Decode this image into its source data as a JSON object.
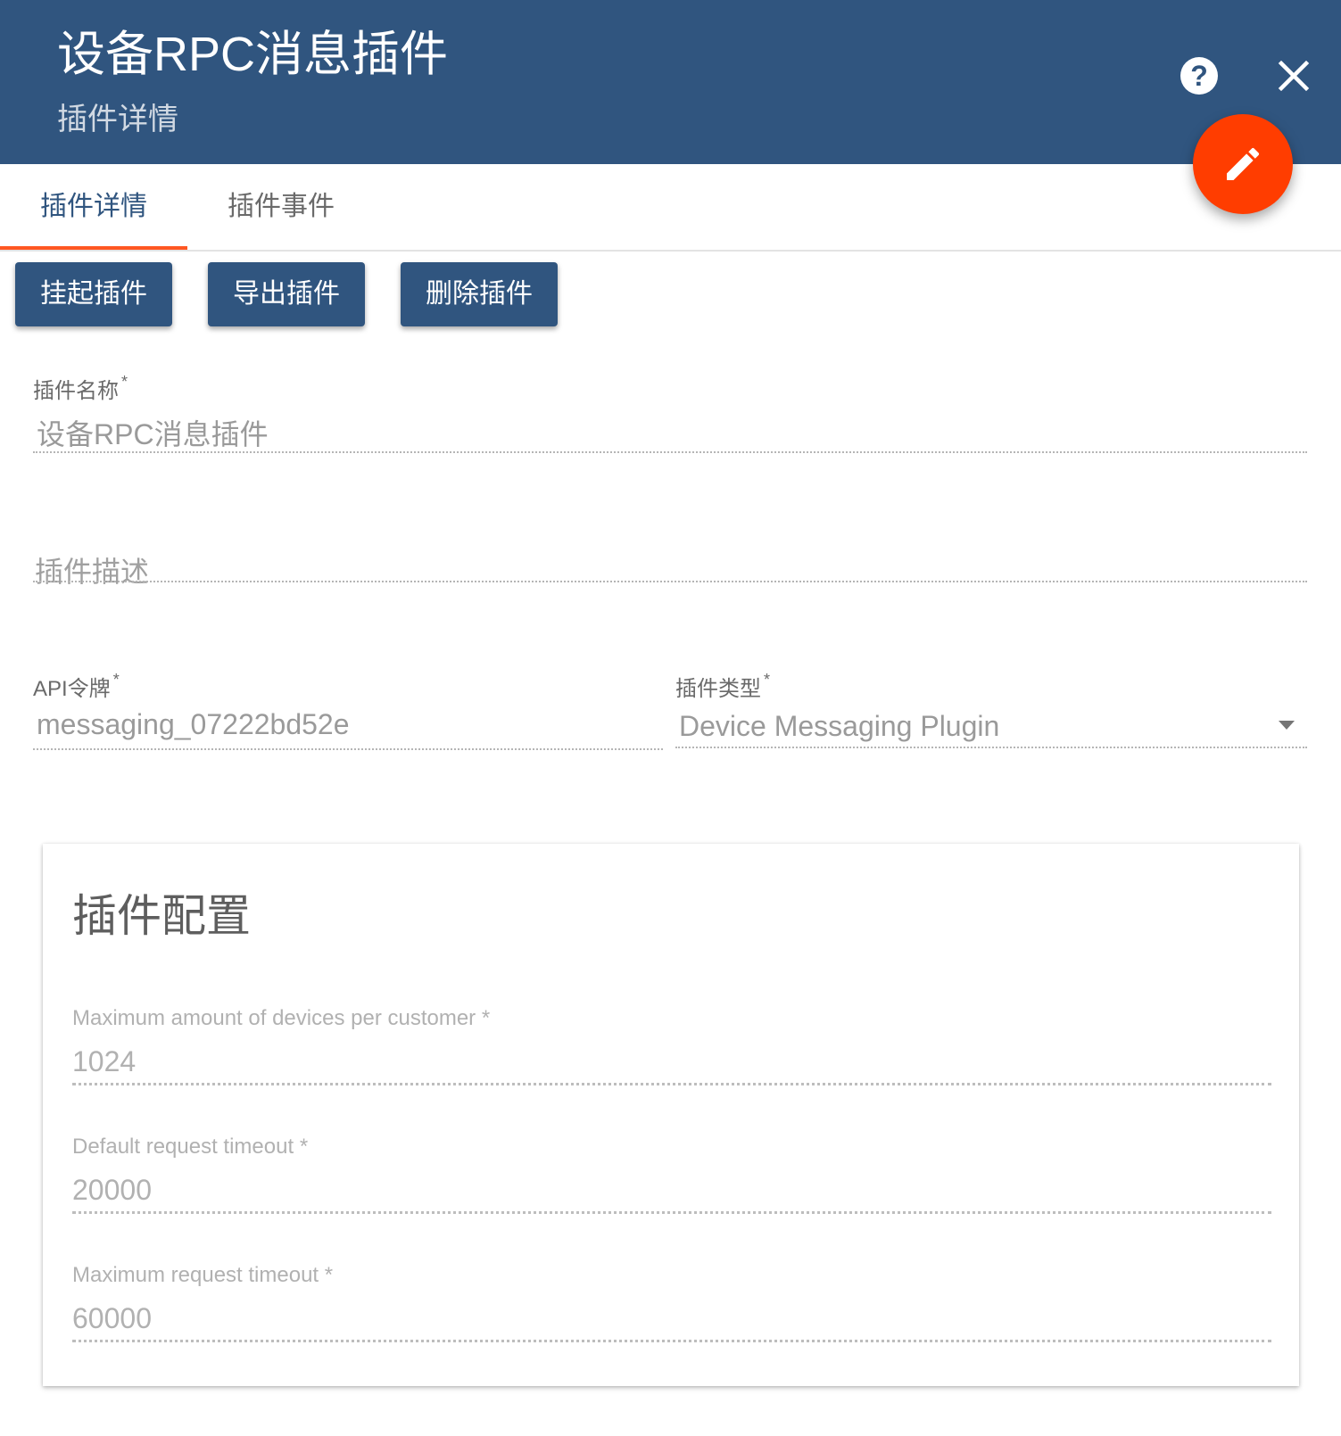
{
  "header": {
    "title": "设备RPC消息插件",
    "subtitle": "插件详情"
  },
  "icons": {
    "help": "help-icon",
    "close": "close-icon",
    "edit": "pencil-icon"
  },
  "colors": {
    "header_bg": "#30557f",
    "accent": "#ff5722",
    "fab": "#ff3d00"
  },
  "tabs": [
    {
      "label": "插件详情",
      "active": true
    },
    {
      "label": "插件事件",
      "active": false
    }
  ],
  "actions": {
    "suspend": "挂起插件",
    "export": "导出插件",
    "delete": "删除插件"
  },
  "form": {
    "name": {
      "label": "插件名称",
      "required": "*",
      "value": "设备RPC消息插件"
    },
    "description": {
      "placeholder": "插件描述"
    },
    "api_token": {
      "label": "API令牌",
      "required": "*",
      "value": "messaging_07222bd52e"
    },
    "type": {
      "label": "插件类型",
      "required": "*",
      "value": "Device Messaging Plugin"
    }
  },
  "config": {
    "title": "插件配置",
    "fields": [
      {
        "label": "Maximum amount of devices per customer",
        "required": "*",
        "value": "1024"
      },
      {
        "label": "Default request timeout",
        "required": "*",
        "value": "20000"
      },
      {
        "label": "Maximum request timeout",
        "required": "*",
        "value": "60000"
      }
    ]
  }
}
